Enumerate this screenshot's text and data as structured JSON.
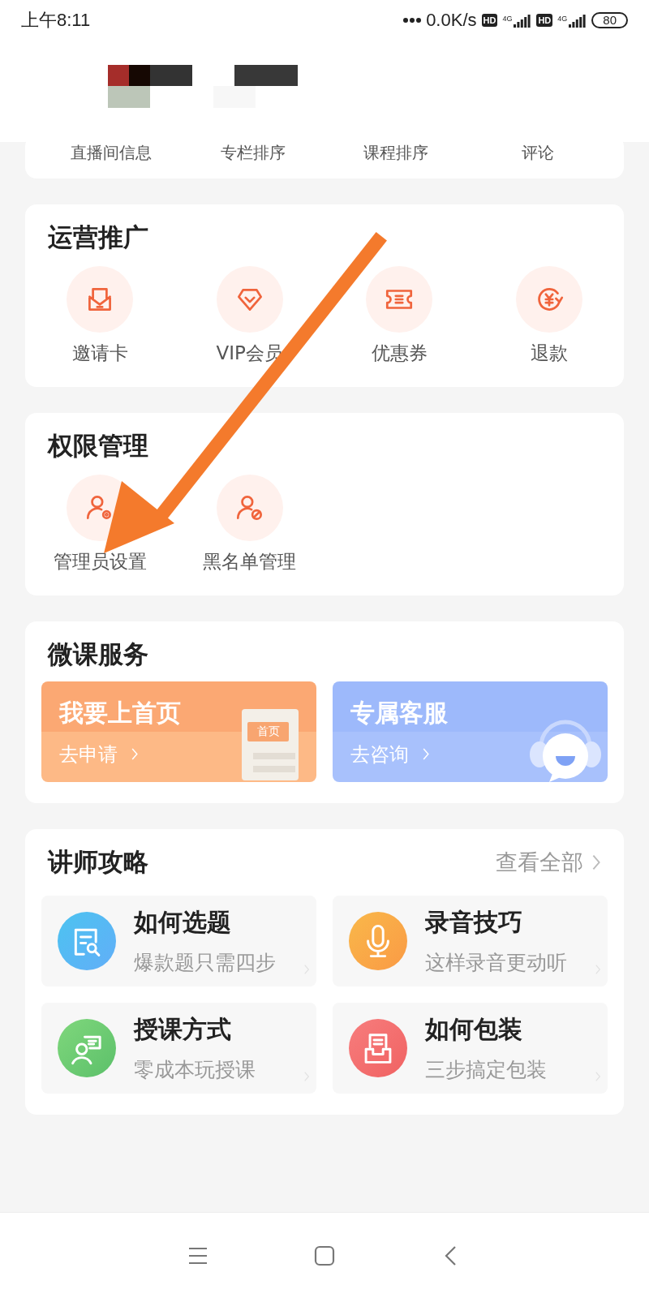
{
  "status_bar": {
    "time": "上午8:11",
    "speed": "0.0K/s",
    "sims": [
      {
        "hd": "HD",
        "network": "4G"
      },
      {
        "hd": "HD",
        "network": "4G"
      }
    ],
    "battery": "80"
  },
  "top_items": [
    "直播间信息",
    "专栏排序",
    "课程排序",
    "评论"
  ],
  "operations": {
    "title": "运营推广",
    "items": [
      {
        "label": "邀请卡",
        "kind": "envelope"
      },
      {
        "label": "VIP会员",
        "kind": "diamond"
      },
      {
        "label": "优惠券",
        "kind": "ticket"
      },
      {
        "label": "退款",
        "kind": "refund"
      }
    ]
  },
  "permissions": {
    "title": "权限管理",
    "items": [
      {
        "label": "管理员设置",
        "kind": "admin"
      },
      {
        "label": "黑名单管理",
        "kind": "block"
      }
    ]
  },
  "services": {
    "title": "微课服务",
    "cards": [
      {
        "title": "我要上首页",
        "action": "去申请",
        "kind": "homepage",
        "badge": "首页"
      },
      {
        "title": "专属客服",
        "action": "去咨询",
        "kind": "support"
      }
    ]
  },
  "guides": {
    "title": "讲师攻略",
    "view_all": "查看全部",
    "items": [
      {
        "title": "如何选题",
        "subtitle": "爆款题只需四步",
        "kind": "topic"
      },
      {
        "title": "录音技巧",
        "subtitle": "这样录音更动听",
        "kind": "mic"
      },
      {
        "title": "授课方式",
        "subtitle": "零成本玩授课",
        "kind": "teach"
      },
      {
        "title": "如何包装",
        "subtitle": "三步搞定包装",
        "kind": "pack"
      }
    ]
  }
}
